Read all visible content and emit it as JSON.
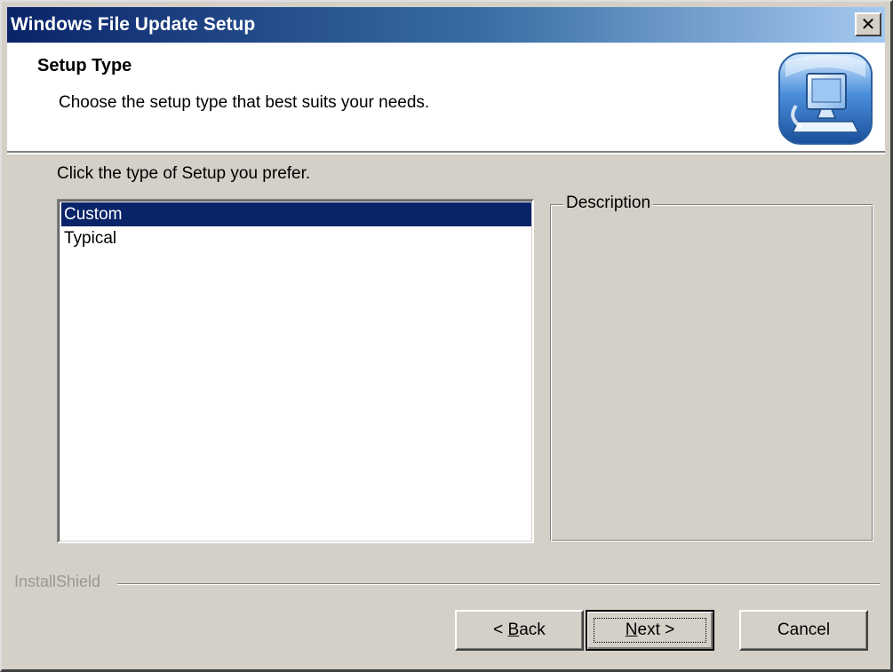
{
  "window": {
    "title": "Windows File Update Setup",
    "close_glyph": "✕"
  },
  "header": {
    "title": "Setup Type",
    "subtitle": "Choose the setup type that best suits your needs.",
    "logo_icon": "computer-setup-icon"
  },
  "main": {
    "prompt": "Click the type of Setup you prefer.",
    "options": [
      {
        "label": "Custom",
        "selected": true
      },
      {
        "label": "Typical",
        "selected": false
      }
    ],
    "description_label": "Description",
    "description_text": ""
  },
  "footer": {
    "brand": "InstallShield",
    "back": {
      "prefix": "< ",
      "accel": "B",
      "rest": "ack"
    },
    "next": {
      "accel": "N",
      "rest": "ext >"
    },
    "cancel": "Cancel"
  },
  "colors": {
    "title_bar_start": "#0a246a",
    "title_bar_end": "#a6caf0",
    "dialog_face": "#d4d0c8",
    "selection": "#0a246a"
  }
}
